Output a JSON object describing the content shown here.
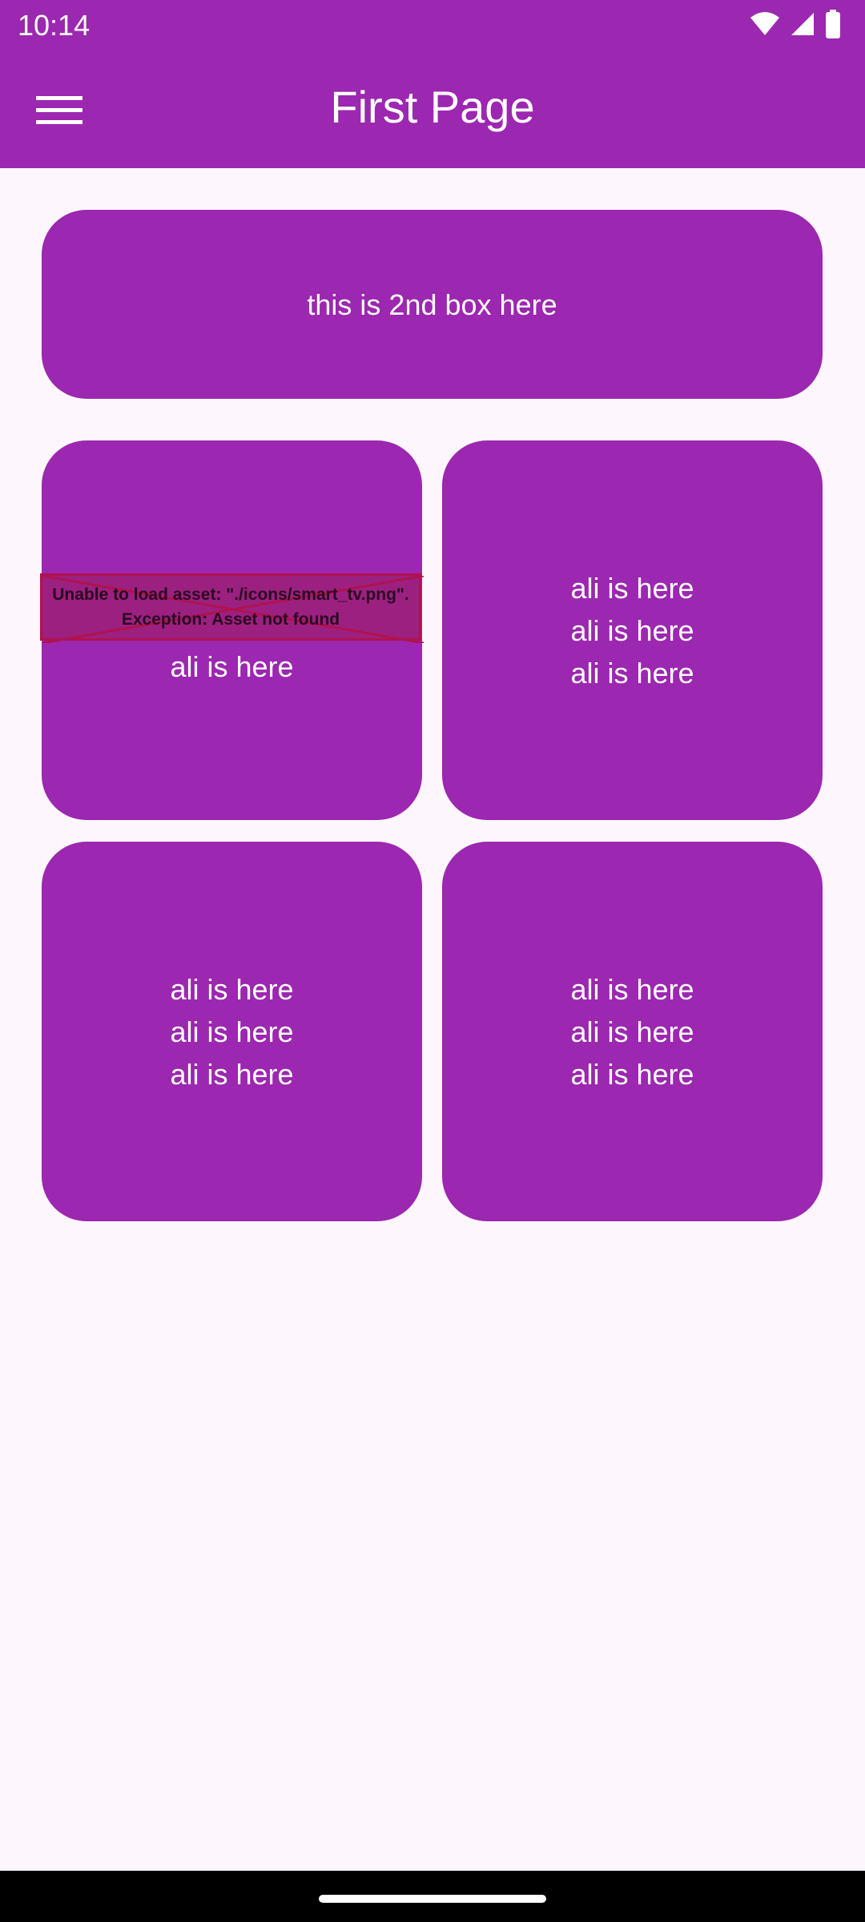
{
  "status_bar": {
    "time": "10:14",
    "icons": [
      "wifi-icon",
      "signal-icon",
      "battery-icon"
    ]
  },
  "app_bar": {
    "title": "First Page",
    "menu_icon": "hamburger-menu-icon"
  },
  "banner_card": {
    "text": "this is 2nd box here"
  },
  "grid_cards": [
    {
      "error": {
        "line1": "Unable to load asset: \"./icons/smart_tv.png\".",
        "line2": "Exception: Asset not found"
      },
      "lines": [
        "ali is here"
      ]
    },
    {
      "lines": [
        "ali is here",
        "ali is here",
        "ali is here"
      ]
    },
    {
      "lines": [
        "ali is here",
        "ali is here",
        "ali is here"
      ]
    },
    {
      "lines": [
        "ali is here",
        "ali is here",
        "ali is here"
      ]
    }
  ],
  "colors": {
    "primary": "#9c27b0",
    "background": "#fdf6fd",
    "on_primary": "#ffffff",
    "error_border": "#b0124e"
  }
}
